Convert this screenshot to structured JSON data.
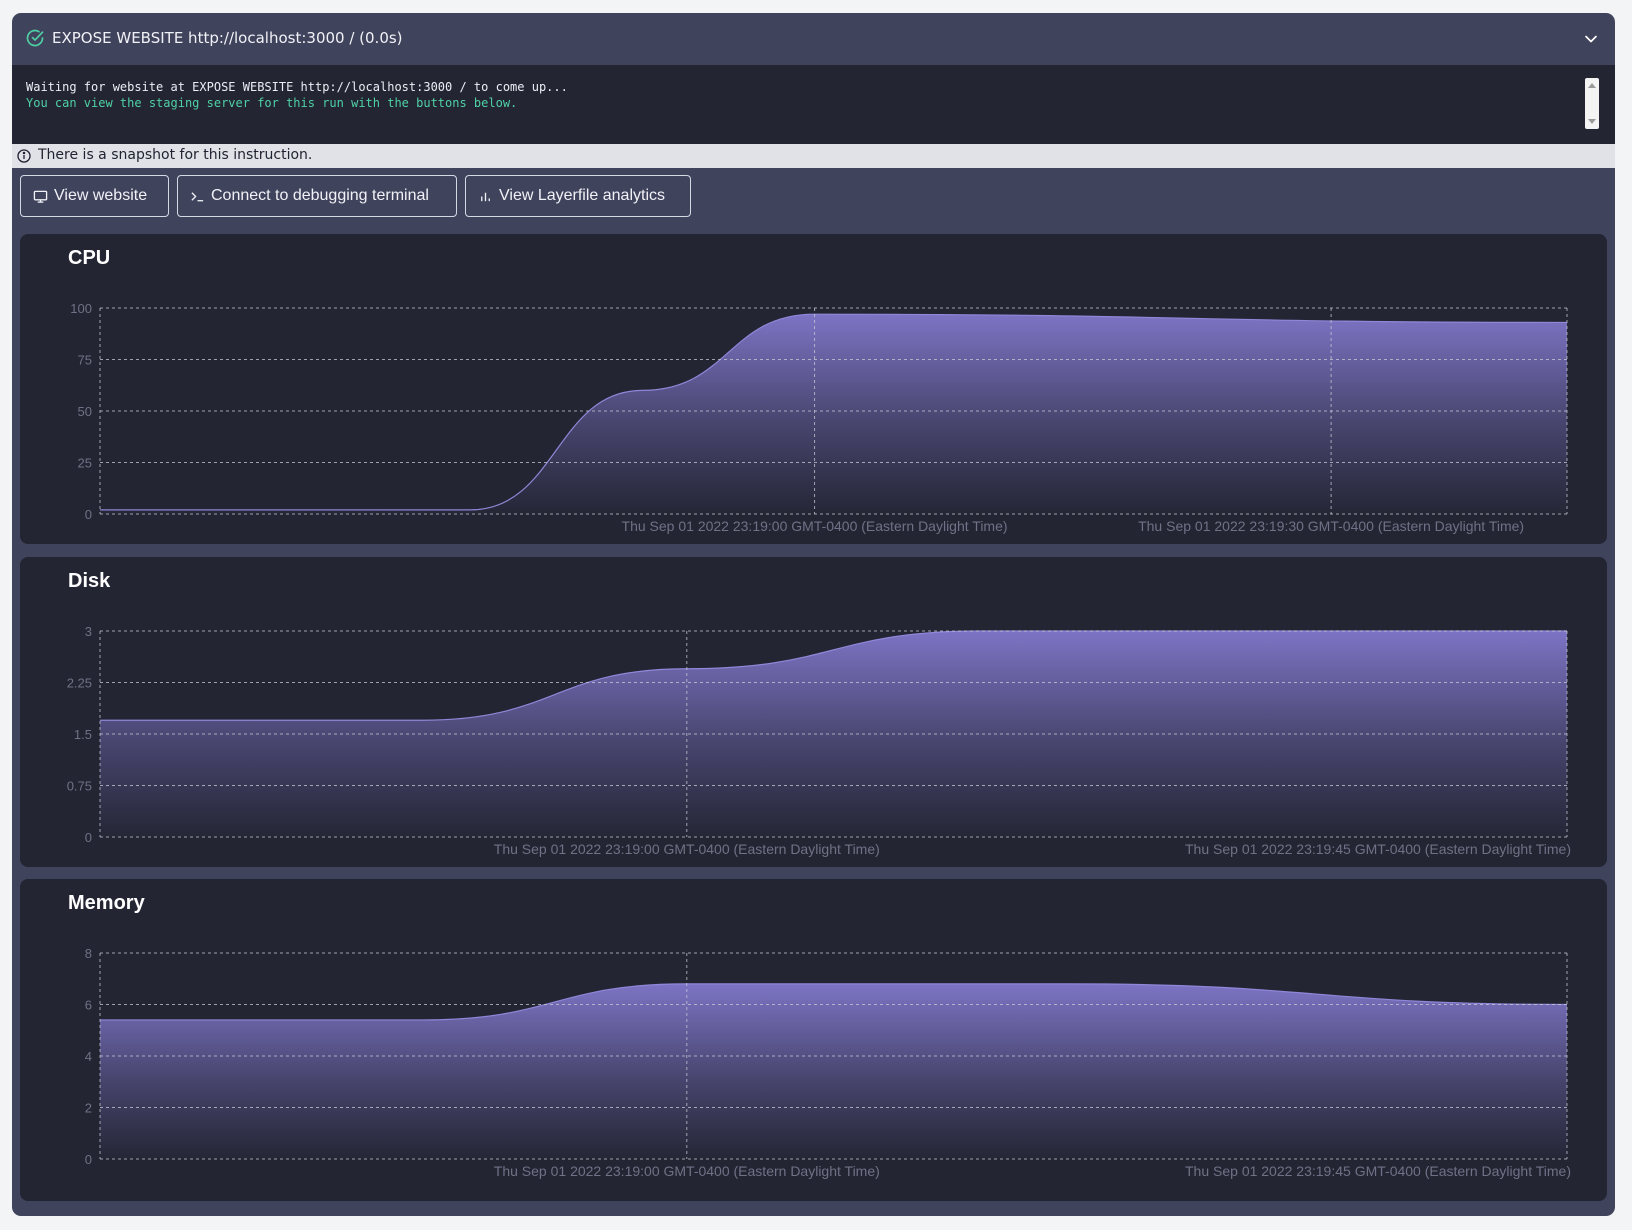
{
  "header": {
    "title": "EXPOSE WEBSITE http://localhost:3000 / (0.0s)",
    "status_icon": "check-circle-icon",
    "collapse_icon": "chevron-down-icon",
    "accent_color": "#4fd1a5"
  },
  "log": {
    "lines": [
      "Waiting for website at EXPOSE WEBSITE http://localhost:3000 / to come up...",
      "You can view the staging server for this run with the buttons below."
    ]
  },
  "snapshot": {
    "text": "There is a snapshot for this instruction."
  },
  "actions": {
    "view_website": "View website",
    "debug_terminal": "Connect to debugging terminal",
    "analytics": "View Layerfile analytics"
  },
  "chart_data": [
    {
      "type": "area",
      "title": "CPU",
      "yticks": [
        "0",
        "25",
        "50",
        "75",
        "100"
      ],
      "ylim": [
        0,
        100
      ],
      "xlim": [
        -41.5,
        43.7
      ],
      "x_ticks": [
        {
          "x": 0,
          "label": "Thu Sep 01 2022 23:19:00 GMT-0400 (Eastern Daylight Time)"
        },
        {
          "x": 30,
          "label": "Thu Sep 01 2022 23:19:30 GMT-0400 (Eastern Daylight Time)"
        }
      ],
      "x": [
        -41.5,
        -20,
        -10,
        0,
        43.7
      ],
      "values": [
        2,
        2,
        60,
        97,
        93
      ],
      "grid": true,
      "color": "#7c74c4"
    },
    {
      "type": "area",
      "title": "Disk",
      "yticks": [
        "0",
        "0.75",
        "1.5",
        "2.25",
        "3"
      ],
      "ylim": [
        0,
        3
      ],
      "xlim": [
        -20,
        30
      ],
      "x_ticks": [
        {
          "x": 0,
          "label": "Thu Sep 01 2022 23:19:00 GMT-0400 (Eastern Daylight Time)"
        },
        {
          "x": 45,
          "label": "Thu Sep 01 2022 23:19:45 GMT-0400 (Eastern Daylight Time)"
        }
      ],
      "x": [
        -20,
        -9,
        0,
        10,
        30
      ],
      "values": [
        1.7,
        1.7,
        2.45,
        3.0,
        3.0
      ],
      "grid": true,
      "color": "#7c74c4"
    },
    {
      "type": "area",
      "title": "Memory",
      "yticks": [
        "0",
        "2",
        "4",
        "6",
        "8"
      ],
      "ylim": [
        0,
        8
      ],
      "xlim": [
        -20,
        30
      ],
      "x_ticks": [
        {
          "x": 0,
          "label": "Thu Sep 01 2022 23:19:00 GMT-0400 (Eastern Daylight Time)"
        },
        {
          "x": 45,
          "label": "Thu Sep 01 2022 23:19:45 GMT-0400 (Eastern Daylight Time)"
        }
      ],
      "x": [
        -20,
        -9,
        0,
        13,
        30
      ],
      "values": [
        5.4,
        5.4,
        6.8,
        6.8,
        6.0
      ],
      "grid": true,
      "color": "#7c74c4"
    }
  ]
}
